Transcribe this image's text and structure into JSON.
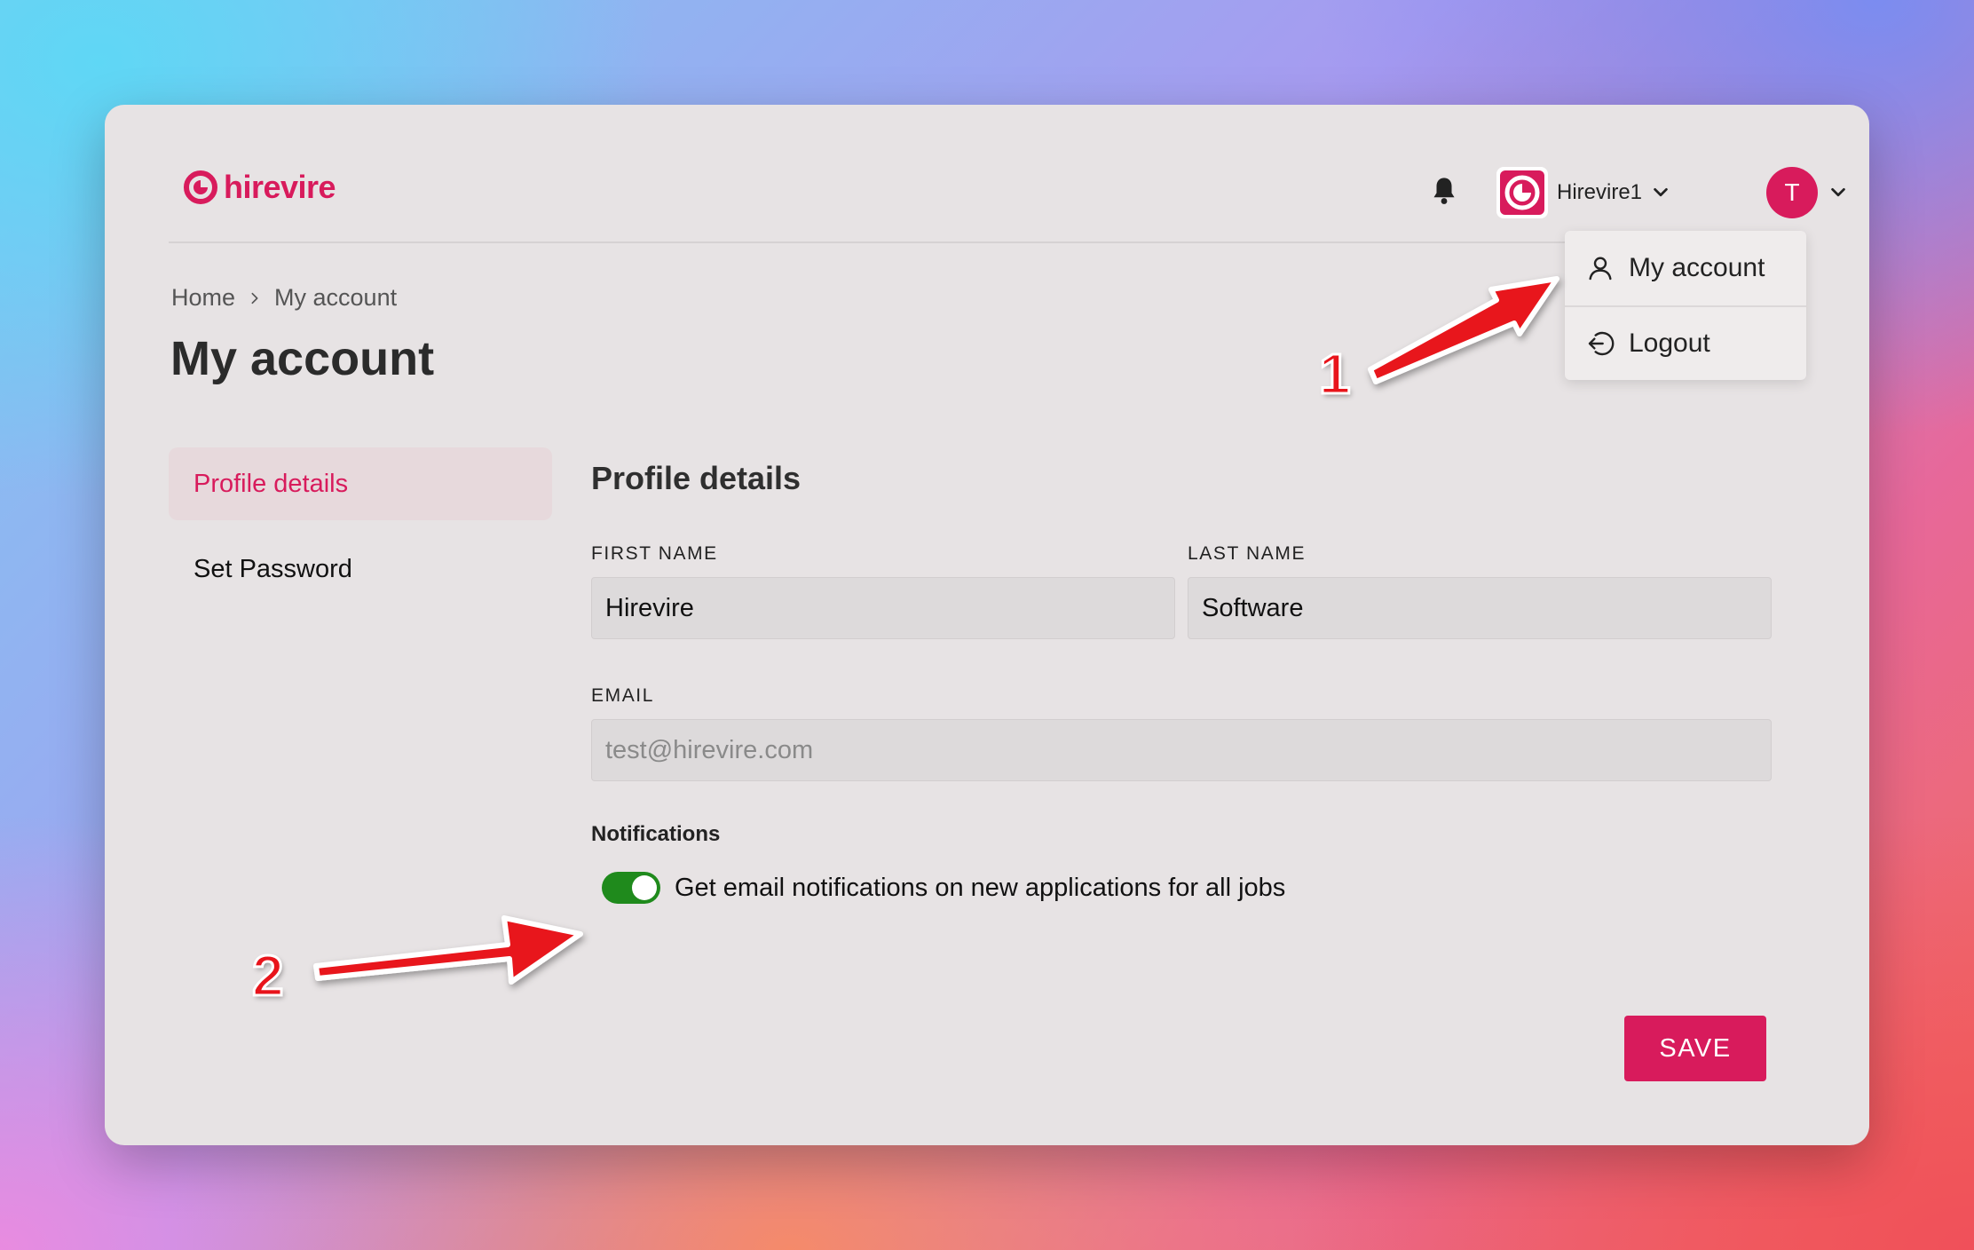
{
  "app": {
    "logo_text": "hirevire",
    "brand_color": "#d81b5c"
  },
  "header": {
    "bell_icon": "bell-icon",
    "org_name": "Hirevire1",
    "avatar_initial": "T"
  },
  "user_menu": {
    "items": [
      {
        "label": "My account",
        "icon": "user-icon"
      },
      {
        "label": "Logout",
        "icon": "logout-icon"
      }
    ]
  },
  "breadcrumb": {
    "home": "Home",
    "current": "My account"
  },
  "page": {
    "title": "My account"
  },
  "side_nav": {
    "items": [
      {
        "label": "Profile details",
        "active": true
      },
      {
        "label": "Set Password",
        "active": false
      }
    ]
  },
  "profile": {
    "section_title": "Profile details",
    "first_name_label": "FIRST NAME",
    "first_name_value": "Hirevire",
    "last_name_label": "LAST NAME",
    "last_name_value": "Software",
    "email_label": "EMAIL",
    "email_value": "test@hirevire.com",
    "notifications_title": "Notifications",
    "notification_toggle_label": "Get email notifications on new applications for all jobs",
    "notification_enabled": true,
    "save_label": "SAVE"
  },
  "annotations": {
    "step1": "1",
    "step2": "2",
    "arrow_color": "#e8141b"
  }
}
